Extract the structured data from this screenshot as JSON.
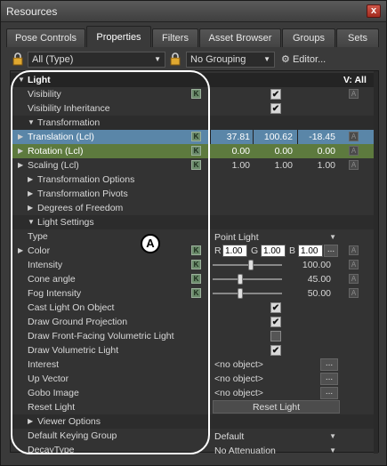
{
  "window": {
    "title": "Resources",
    "close": "x"
  },
  "tabs": [
    "Pose Controls",
    "Properties",
    "Filters",
    "Asset Browser",
    "Groups",
    "Sets"
  ],
  "toolbar": {
    "filter": "All (Type)",
    "grouping": "No Grouping",
    "editor": "Editor..."
  },
  "header": {
    "label": "Light",
    "v": "V: All"
  },
  "rows": {
    "visibility": "Visibility",
    "vis_inherit": "Visibility Inheritance",
    "transformation": "Transformation",
    "translation": "Translation (Lcl)",
    "rotation": "Rotation (Lcl)",
    "scaling": "Scaling (Lcl)",
    "transform_options": "Transformation Options",
    "transform_pivots": "Transformation Pivots",
    "dof": "Degrees of Freedom",
    "light_settings": "Light Settings",
    "type": "Type",
    "color": "Color",
    "intensity": "Intensity",
    "cone": "Cone angle",
    "fog": "Fog Intensity",
    "cast": "Cast Light On Object",
    "ground": "Draw Ground Projection",
    "frontvol": "Draw Front-Facing Volumetric Light",
    "vol": "Draw Volumetric Light",
    "interest": "Interest",
    "up": "Up Vector",
    "gobo": "Gobo Image",
    "reset": "Reset Light",
    "viewer": "Viewer Options",
    "keying": "Default Keying Group",
    "decay": "DecayType"
  },
  "values": {
    "translation": [
      "37.81",
      "100.62",
      "-18.45"
    ],
    "rotation": [
      "0.00",
      "0.00",
      "0.00"
    ],
    "scaling": [
      "1.00",
      "1.00",
      "1.00"
    ],
    "type": "Point Light",
    "color": {
      "r_label": "R",
      "r": "1.00",
      "g_label": "G",
      "g": "1.00",
      "b_label": "B",
      "b": "1.00",
      "btn": "..."
    },
    "intensity": "100.00",
    "cone": "45.00",
    "fog": "50.00",
    "no_object": "<no object>",
    "obj_btn": "...",
    "reset_btn": "Reset Light",
    "keying": "Default",
    "decay": "No Attenuation"
  },
  "badges": {
    "k": "K",
    "a": "A",
    "callout": "A"
  },
  "sliders": {
    "intensity": 0.55,
    "cone": 0.4,
    "fog": 0.4
  }
}
